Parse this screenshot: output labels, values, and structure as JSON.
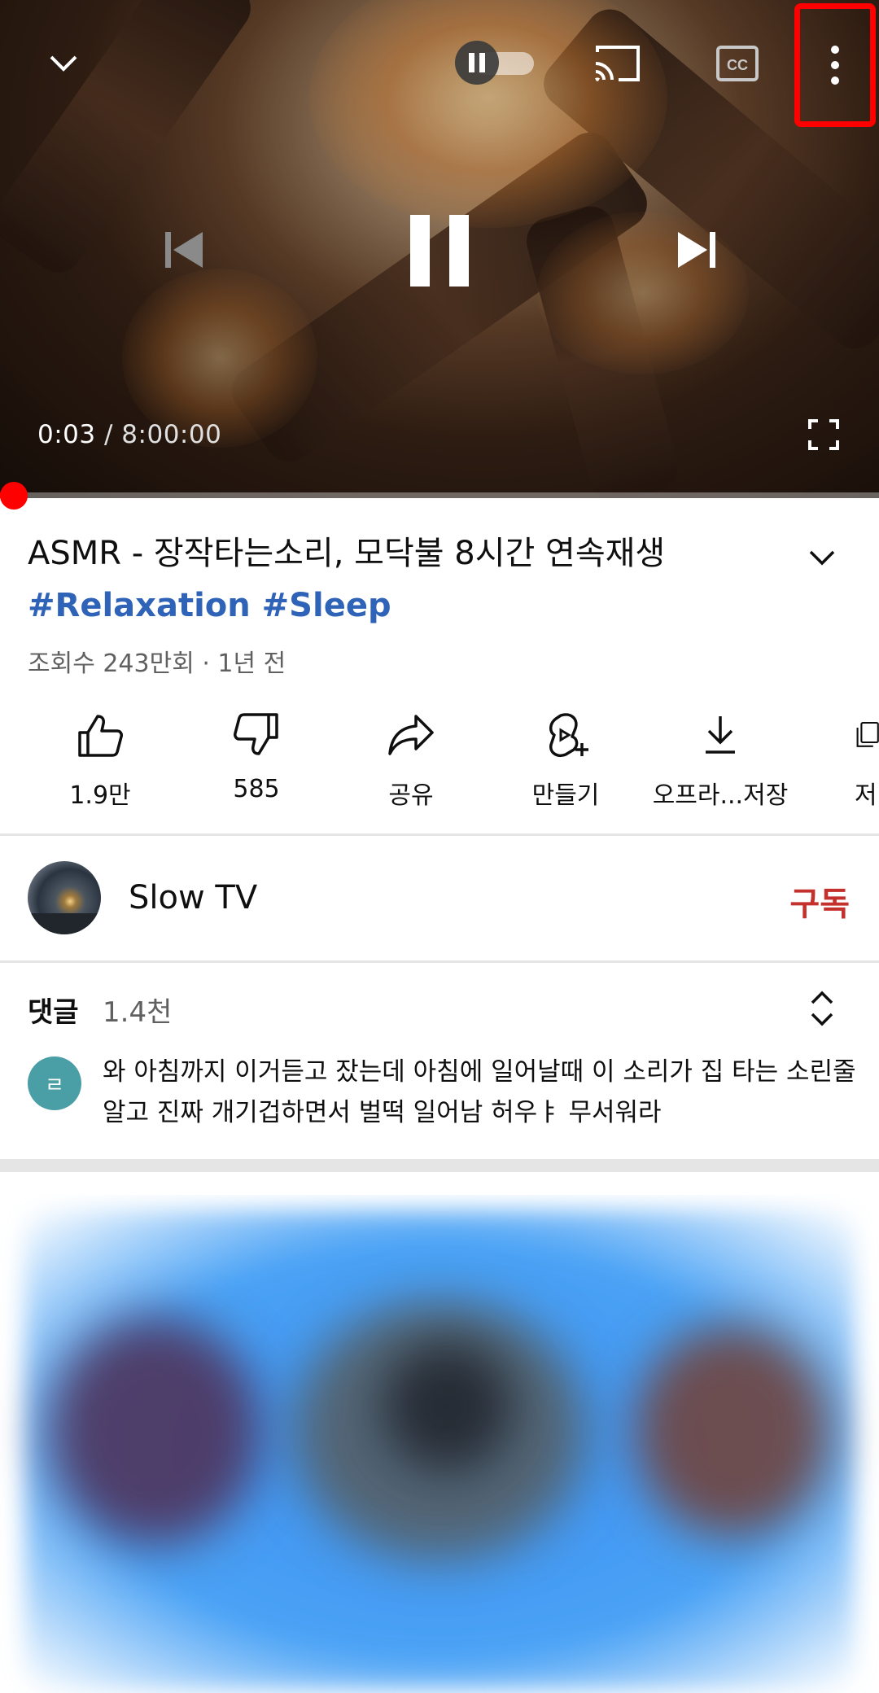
{
  "player": {
    "time_current": "0:03",
    "time_separator": "/",
    "time_total": "8:00:00",
    "progress_fraction": 0.000104,
    "autoplay_on": false,
    "icons": {
      "collapse": "chevron-down-icon",
      "autoplay": "autoplay-toggle-icon",
      "cast": "cast-icon",
      "captions": "cc-icon",
      "more": "more-vertical-icon",
      "previous": "skip-previous-icon",
      "play_pause": "pause-icon",
      "next": "skip-next-icon",
      "fullscreen": "fullscreen-icon"
    },
    "accent_color": "#ff0000"
  },
  "video": {
    "title": "ASMR - 장작타는소리, 모닥불 8시간 연속재생",
    "hashtags": "#Relaxation #Sleep",
    "meta": "조회수 243만회 · 1년 전"
  },
  "actions": [
    {
      "id": "like",
      "label": "1.9만",
      "icon": "thumbs-up-icon"
    },
    {
      "id": "dislike",
      "label": "585",
      "icon": "thumbs-down-icon"
    },
    {
      "id": "share",
      "label": "공유",
      "icon": "share-icon"
    },
    {
      "id": "create",
      "label": "만들기",
      "icon": "remix-icon"
    },
    {
      "id": "download",
      "label": "오프라...저장",
      "icon": "download-icon"
    },
    {
      "id": "save",
      "label": "저",
      "icon": "save-icon"
    }
  ],
  "channel": {
    "name": "Slow TV",
    "subscribe_label": "구독",
    "subscribe_color": "#c4302b"
  },
  "comments": {
    "label": "댓글",
    "count": "1.4천",
    "top_comment_avatar_letter": "ㄹ",
    "top_comment": "와 아침까지 이거듣고 잤는데 아침에 일어날때 이 소리가 집 타는 소린줄 알고 진짜 개기겁하면서 벌떡 일어남 허우ㅑ 무서워라"
  }
}
